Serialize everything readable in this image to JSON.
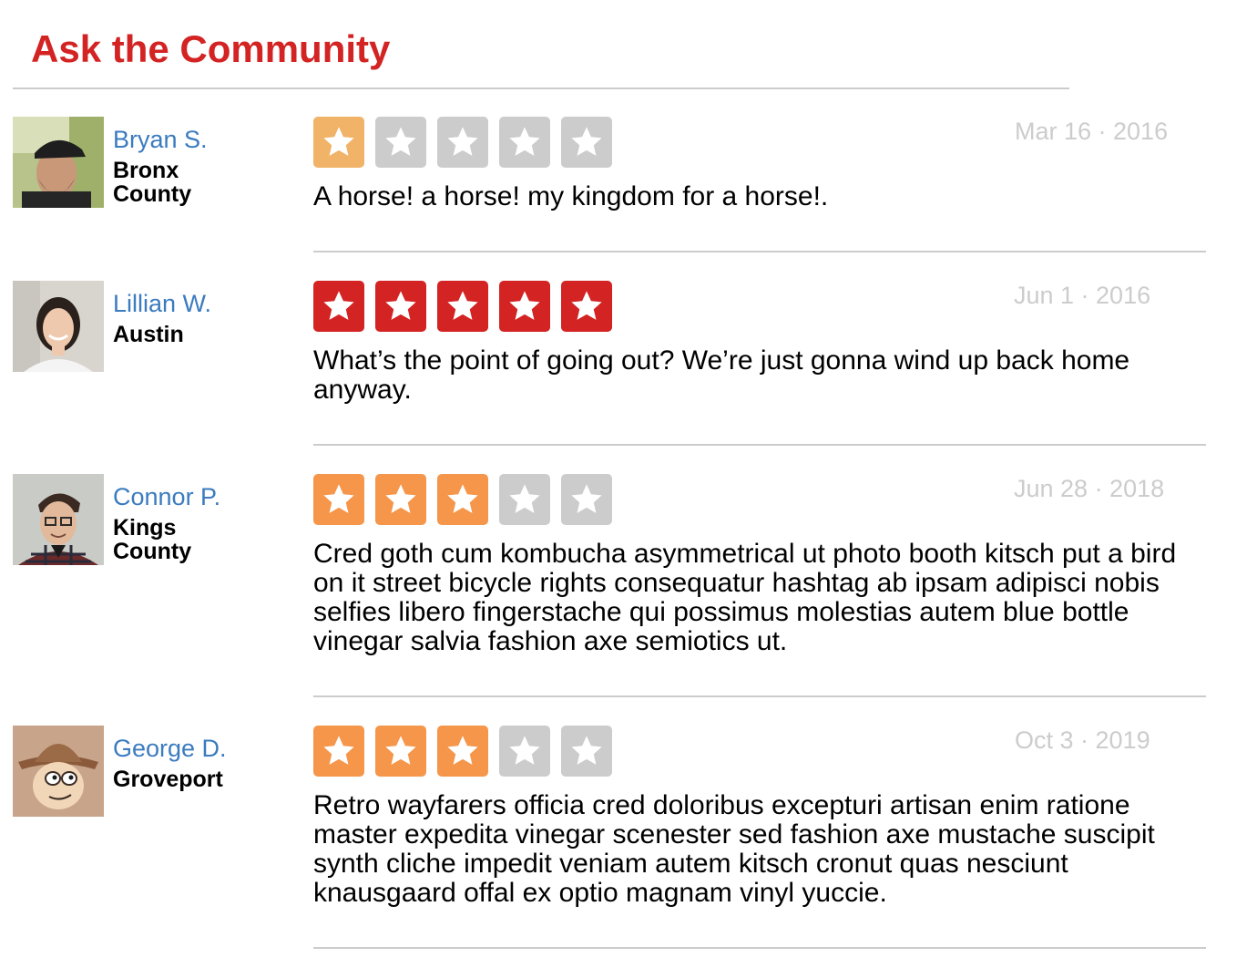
{
  "header": {
    "title": "Ask the Community"
  },
  "colors": {
    "title": "#d32323",
    "user_link": "#3b7bbf",
    "date": "#cccccc",
    "star_empty": "#cccccc",
    "star_one": "#f0b367",
    "star_three": "#f5964a",
    "star_five": "#d32323",
    "divider": "#cccccc"
  },
  "reviews": [
    {
      "user": {
        "name": "Bryan S.",
        "location": "Bronx County",
        "avatar": "man-with-cap-avatar"
      },
      "rating": 1,
      "rating_color": "#f0b367",
      "date": "Mar 16 · 2016",
      "text": "A horse! a horse! my kingdom for a horse!."
    },
    {
      "user": {
        "name": "Lillian W.",
        "location": "Austin",
        "avatar": "woman-smiling-avatar"
      },
      "rating": 5,
      "rating_color": "#d32323",
      "date": "Jun 1 · 2016",
      "text": "What’s the point of going out? We’re just gonna wind up back home anyway."
    },
    {
      "user": {
        "name": "Connor P.",
        "location": "Kings County",
        "avatar": "man-plaid-shirt-avatar"
      },
      "rating": 3,
      "rating_color": "#f5964a",
      "date": "Jun 28 · 2018",
      "text": "Cred goth cum kombucha asymmetrical ut photo booth kitsch put a bird on it street bicycle rights consequatur hashtag ab ipsam adipisci nobis selfies libero fingerstache qui possimus molestias autem blue bottle vinegar salvia fashion axe semiotics ut."
    },
    {
      "user": {
        "name": "George D.",
        "location": "Groveport",
        "avatar": "cartoon-cowboy-avatar"
      },
      "rating": 3,
      "rating_color": "#f5964a",
      "date": "Oct 3 · 2019",
      "text": "Retro wayfarers officia cred doloribus excepturi artisan enim ratione master expedita vinegar scenester sed fashion axe mustache suscipit synth cliche impedit veniam autem kitsch cronut quas nesciunt knausgaard offal ex optio magnam vinyl yuccie."
    }
  ]
}
